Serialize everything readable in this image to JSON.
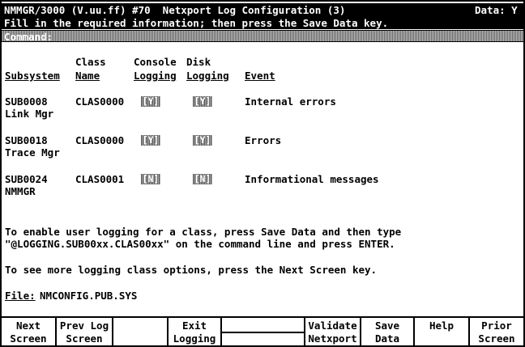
{
  "header": {
    "title": "NMMGR/3000 (V.uu.ff) #70  Netxport Log Configuration (3)",
    "data_flag": "Data: Y",
    "instruction": "Fill in the required information; then press the Save Data key.",
    "command_label": "Command:"
  },
  "columns": {
    "class_top": "Class",
    "console_top": "Console",
    "disk_top": "Disk",
    "subsystem": "Subsystem",
    "class_name": "Name",
    "console_logging": "Logging",
    "disk_logging": "Logging",
    "event": "Event"
  },
  "rows": [
    {
      "subsystem": "SUB0008",
      "subsystem_name": "Link Mgr",
      "class": "CLAS0000",
      "console": "[Y]",
      "disk": "[Y]",
      "event": "Internal errors"
    },
    {
      "subsystem": "SUB0018",
      "subsystem_name": "Trace Mgr",
      "class": "CLAS0000",
      "console": "[Y]",
      "disk": "[Y]",
      "event": "Errors"
    },
    {
      "subsystem": "SUB0024",
      "subsystem_name": "NMMGR",
      "class": "CLAS0001",
      "console": "[N]",
      "disk": "[N]",
      "event": "Informational messages"
    }
  ],
  "help_text": {
    "line1": "To enable user logging for a class, press Save Data and then type",
    "line2": "\"@LOGGING.SUB00xx.CLAS00xx\" on the command line and press ENTER.",
    "line3": "To see more logging class options, press the Next Screen key."
  },
  "file": {
    "label": "File:",
    "value": "NMCONFIG.PUB.SYS"
  },
  "softkeys": [
    {
      "l1": "Next",
      "l2": "Screen"
    },
    {
      "l1": "Prev Log",
      "l2": "Screen"
    },
    {
      "l1": "",
      "l2": ""
    },
    {
      "l1": "Exit",
      "l2": "Logging"
    },
    {
      "l1": "",
      "l2": ""
    },
    {
      "l1": "Validate",
      "l2": "Netxport"
    },
    {
      "l1": "Save",
      "l2": "Data"
    },
    {
      "l1": "Help",
      "l2": ""
    },
    {
      "l1": "Prior",
      "l2": "Screen"
    }
  ]
}
